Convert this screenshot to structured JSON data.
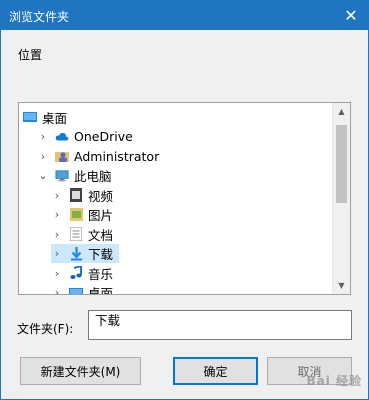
{
  "window": {
    "title": "浏览文件夹",
    "close_glyph": "✕"
  },
  "location_label": "位置",
  "tree": {
    "items": [
      {
        "label": "桌面",
        "icon": "desktop-icon",
        "level": 0,
        "chevron": "",
        "selected": false
      },
      {
        "label": "OneDrive",
        "icon": "cloud-icon",
        "level": 1,
        "chevron": "›",
        "selected": false
      },
      {
        "label": "Administrator",
        "icon": "user-folder-icon",
        "level": 1,
        "chevron": "›",
        "selected": false
      },
      {
        "label": "此电脑",
        "icon": "computer-icon",
        "level": 1,
        "chevron": "⌄",
        "selected": false
      },
      {
        "label": "视频",
        "icon": "video-folder-icon",
        "level": 2,
        "chevron": "›",
        "selected": false
      },
      {
        "label": "图片",
        "icon": "pictures-folder-icon",
        "level": 2,
        "chevron": "›",
        "selected": false
      },
      {
        "label": "文档",
        "icon": "documents-folder-icon",
        "level": 2,
        "chevron": "›",
        "selected": false
      },
      {
        "label": "下载",
        "icon": "downloads-folder-icon",
        "level": 2,
        "chevron": "›",
        "selected": true
      },
      {
        "label": "音乐",
        "icon": "music-folder-icon",
        "level": 2,
        "chevron": "›",
        "selected": false
      },
      {
        "label": "桌面",
        "icon": "desktop-folder-icon",
        "level": 2,
        "chevron": "›",
        "selected": false
      }
    ],
    "scroll_up_glyph": "▲",
    "scroll_down_glyph": "▼"
  },
  "folder_field": {
    "label": "文件夹(F):",
    "value": "下载"
  },
  "buttons": {
    "new_folder": "新建文件夹(M)",
    "ok": "确定",
    "cancel": "取消"
  },
  "watermark": "Bai 经验",
  "colors": {
    "titlebar": "#1f75c0",
    "selection": "#cce8ff",
    "default_button_border": "#0078d7"
  }
}
